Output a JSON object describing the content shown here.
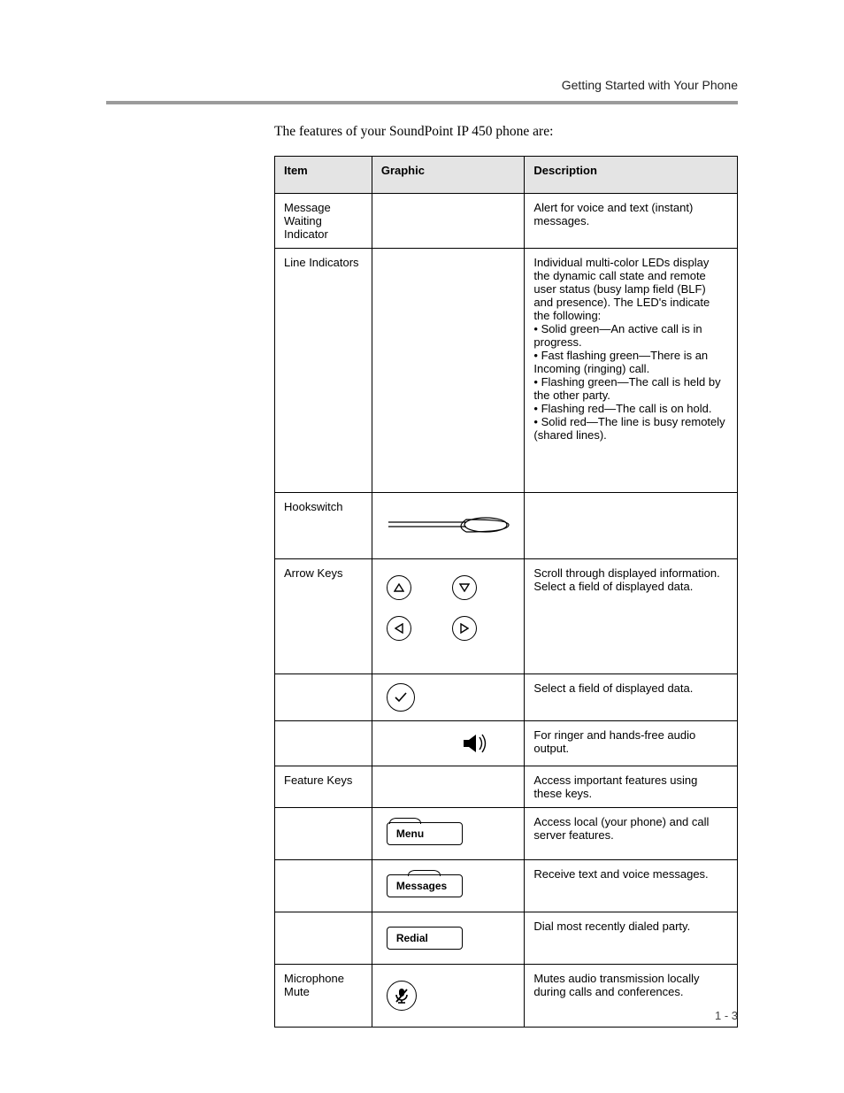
{
  "header": {
    "title": "Getting Started with Your Phone"
  },
  "intro": "The features of your SoundPoint IP 450 phone are:",
  "table": {
    "headers": {
      "item": "Item",
      "graphic": "Graphic",
      "desc": "Description"
    },
    "rows": [
      {
        "item": "Message Waiting Indicator",
        "graphic": {
          "type": "none"
        },
        "desc": "Alert for voice and text (instant) messages."
      },
      {
        "item": "Line Indicators",
        "graphic": {
          "type": "none"
        },
        "desc": "Individual multi-color LEDs display the dynamic call state and remote user status (busy lamp field (BLF) and presence). The LED's indicate the following:\n• Solid green—An active call is in progress.\n• Fast flashing green—There is an Incoming (ringing) call.\n• Flashing green—The call is held by the other party.\n• Flashing red—The call is on hold.\n• Solid red—The line is busy remotely (shared lines)."
      },
      {
        "item": "Hookswitch",
        "graphic": {
          "type": "hookswitch"
        },
        "desc": ""
      },
      {
        "item": "Arrow Keys",
        "graphic": {
          "type": "arrows"
        },
        "desc": "Scroll through displayed information.\nSelect a field of displayed data."
      },
      {
        "item": "",
        "graphic": {
          "type": "check"
        },
        "desc": "Select a field of displayed data."
      },
      {
        "item": "",
        "graphic": {
          "type": "speaker"
        },
        "desc": "For ringer and hands-free audio output."
      },
      {
        "item": "Feature Keys",
        "graphic": {
          "type": "none"
        },
        "desc": "Access important features using these keys."
      },
      {
        "item": "",
        "graphic": {
          "type": "pill",
          "label": "Menu"
        },
        "desc": "Access local (your phone) and call server features."
      },
      {
        "item": "",
        "graphic": {
          "type": "pill",
          "label": "Messages"
        },
        "desc": "Receive text and voice messages."
      },
      {
        "item": "",
        "graphic": {
          "type": "pill",
          "label": "Redial"
        },
        "desc": "Dial most recently dialed party."
      },
      {
        "item": "Microphone Mute",
        "graphic": {
          "type": "mute"
        },
        "desc": "Mutes audio transmission locally during calls and conferences."
      }
    ]
  },
  "pill_labels": {
    "menu": "Menu",
    "messages": "Messages",
    "redial": "Redial"
  },
  "page_number": "1 - 3",
  "icons": {
    "hookswitch": "hookswitch-icon",
    "arrow_up": "arrow-up-icon",
    "arrow_down": "arrow-down-icon",
    "arrow_left": "arrow-left-icon",
    "arrow_right": "arrow-right-icon",
    "check": "check-icon",
    "speaker": "speaker-icon",
    "mute": "microphone-mute-icon"
  }
}
